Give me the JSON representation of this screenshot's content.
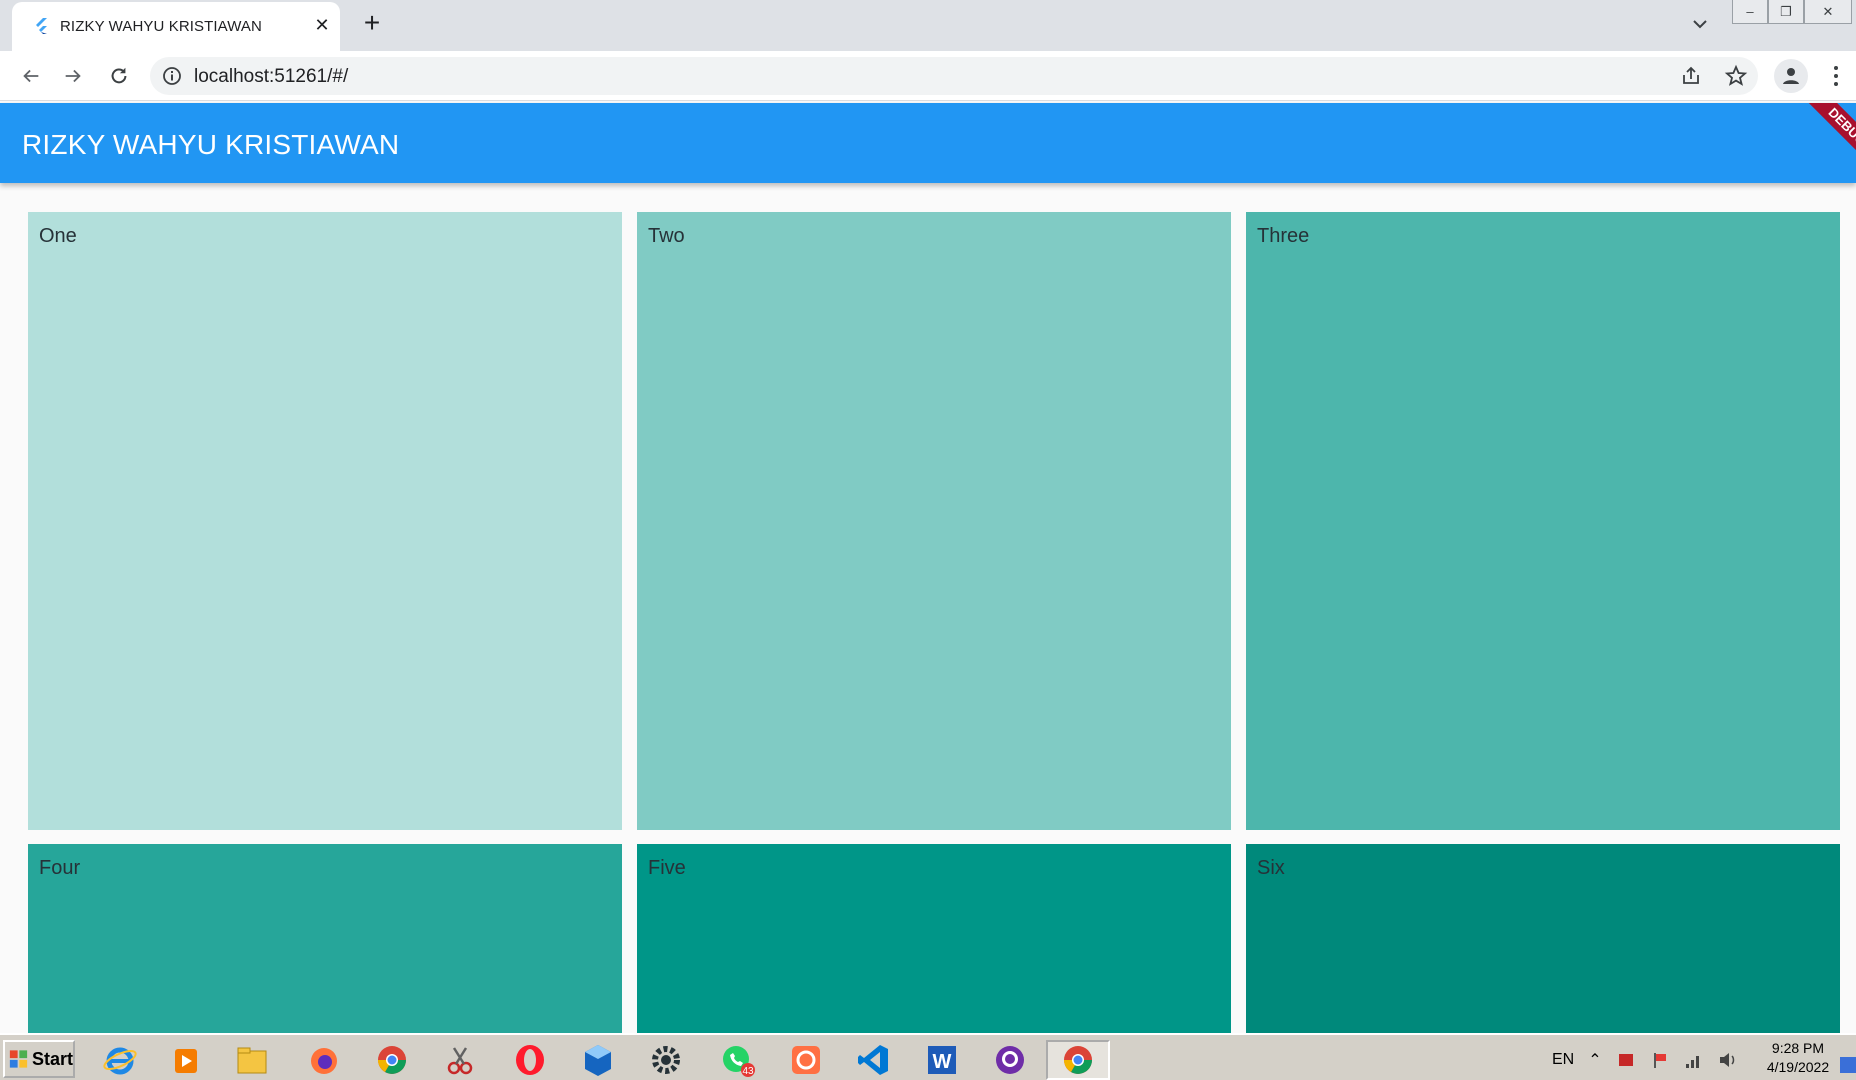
{
  "browser": {
    "tab": {
      "title": "RIZKY WAHYU KRISTIAWAN",
      "favicon": "flutter-icon",
      "close_icon": "close-icon"
    },
    "new_tab_icon": "plus-icon",
    "tab_search_icon": "chevron-down-icon",
    "window_controls": [
      "minimize-icon",
      "restore-icon",
      "close-icon"
    ],
    "nav": [
      "back-arrow-icon",
      "forward-arrow-icon",
      "reload-icon"
    ],
    "address": {
      "url": "localhost:51261/#/",
      "info_icon": "info-icon",
      "share_icon": "share-icon",
      "bookmark_icon": "star-icon"
    },
    "profile_icon": "profile-icon",
    "menu_icon": "more-vert-icon"
  },
  "app": {
    "title": "RIZKY WAHYU KRISTIAWAN",
    "debug_banner": "DEBUG",
    "appbar_color": "#2196f3",
    "tiles": [
      {
        "label": "One",
        "color": "#b2dfdb"
      },
      {
        "label": "Two",
        "color": "#80cbc4"
      },
      {
        "label": "Three",
        "color": "#4db6ac"
      },
      {
        "label": "Four",
        "color": "#26a69a"
      },
      {
        "label": "Five",
        "color": "#009688"
      },
      {
        "label": "Six",
        "color": "#00897b"
      }
    ]
  },
  "taskbar": {
    "start_label": "Start",
    "apps": [
      "internet-explorer-icon",
      "media-player-icon",
      "folder-icon",
      "firefox-icon",
      "chrome-icon",
      "snipping-tool-icon",
      "opera-icon",
      "virtualbox-icon",
      "settings-gear-icon",
      "whatsapp-icon",
      "orange-app-icon",
      "vscode-icon",
      "word-icon",
      "github-icon",
      "chrome-icon"
    ],
    "whatsapp_badge": "43",
    "tray": {
      "language": "EN",
      "icons": [
        "tray-arrow-icon",
        "tray-shield-icon",
        "tray-flag-icon",
        "network-icon",
        "volume-icon"
      ]
    },
    "clock": {
      "time": "9:28 PM",
      "date": "4/19/2022"
    }
  }
}
